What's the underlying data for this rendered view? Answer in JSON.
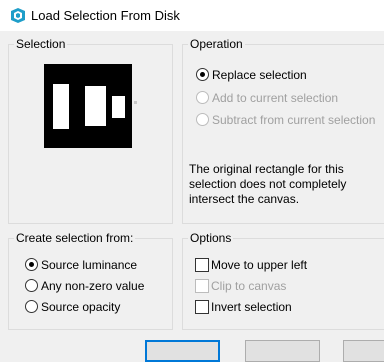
{
  "window": {
    "title": "Load Selection From Disk",
    "icon": "app-logo-icon",
    "accent_color": "#1e9ec9"
  },
  "selection_group": {
    "label": "Selection"
  },
  "operation_group": {
    "label": "Operation",
    "options": [
      {
        "label": "Replace selection",
        "selected": true,
        "enabled": true
      },
      {
        "label": "Add to current selection",
        "selected": false,
        "enabled": false
      },
      {
        "label": "Subtract from current selection",
        "selected": false,
        "enabled": false
      }
    ],
    "note": "The original rectangle for this selection does not completely intersect the canvas."
  },
  "create_group": {
    "label": "Create selection from:",
    "options": [
      {
        "label": "Source luminance",
        "selected": true
      },
      {
        "label": "Any non-zero value",
        "selected": false
      },
      {
        "label": "Source opacity",
        "selected": false
      }
    ]
  },
  "options_group": {
    "label": "Options",
    "items": [
      {
        "label": "Move to upper left",
        "checked": false,
        "enabled": true
      },
      {
        "label": "Clip to canvas",
        "checked": false,
        "enabled": false
      },
      {
        "label": "Invert selection",
        "checked": false,
        "enabled": true
      }
    ]
  }
}
